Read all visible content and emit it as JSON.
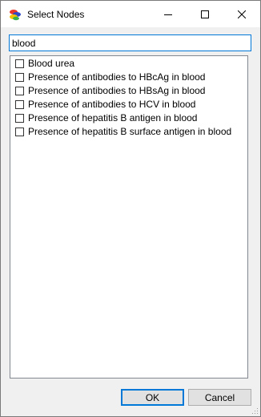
{
  "window": {
    "title": "Select Nodes"
  },
  "titlebar_buttons": {
    "minimize_icon": "minimize-icon",
    "maximize_icon": "maximize-icon",
    "close_icon": "close-icon"
  },
  "search": {
    "value": "blood"
  },
  "nodes": [
    {
      "label": "Blood urea",
      "checked": false
    },
    {
      "label": "Presence of antibodies to HBcAg in blood",
      "checked": false
    },
    {
      "label": "Presence of antibodies to HBsAg in blood",
      "checked": false
    },
    {
      "label": "Presence of antibodies to HCV in blood",
      "checked": false
    },
    {
      "label": "Presence of hepatitis B antigen in blood",
      "checked": false
    },
    {
      "label": "Presence of hepatitis B surface antigen in blood",
      "checked": false
    }
  ],
  "buttons": {
    "ok_label": "OK",
    "cancel_label": "Cancel"
  },
  "colors": {
    "focus_border": "#0078d7",
    "dialog_background": "#f0f0f0"
  }
}
